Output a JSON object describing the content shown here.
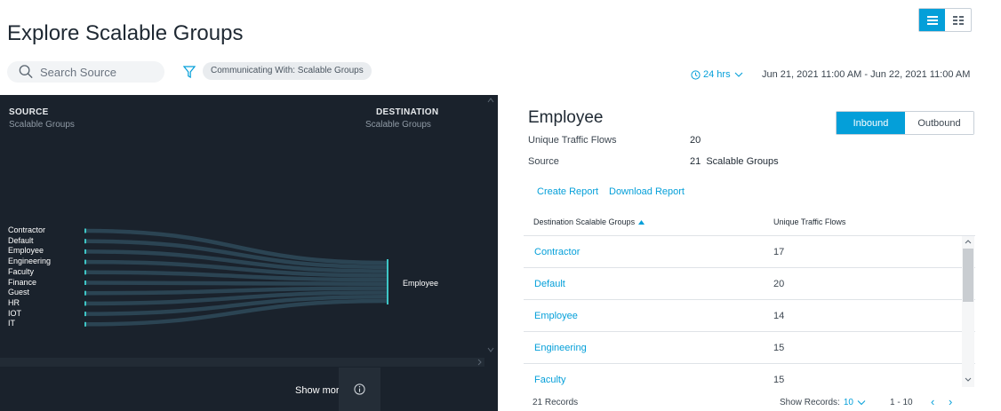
{
  "header": {
    "title": "Explore Scalable Groups",
    "view_toggle": {
      "selected": "list-view-icon",
      "other": "grid-view-icon"
    }
  },
  "toolbar": {
    "search_placeholder": "Search Source",
    "filter_chip": "Communicating With: Scalable Groups",
    "time_range": "24 hrs",
    "date_range": "Jun 21, 2021 11:00 AM - Jun 22, 2021 11:00 AM"
  },
  "viz": {
    "source_heading": "SOURCE",
    "source_sub": "Scalable Groups",
    "destination_heading": "DESTINATION",
    "destination_sub": "Scalable Groups",
    "sources": [
      "Contractor",
      "Default",
      "Employee",
      "Engineering",
      "Faculty",
      "Finance",
      "Guest",
      "HR",
      "IOT",
      "IT"
    ],
    "destination": "Employee",
    "show_more": "Show more",
    "colors": {
      "background": "#1a222c",
      "flow": "#2f4a5a",
      "node": "#3ec6c6"
    }
  },
  "panel": {
    "title": "Employee",
    "direction_tabs": [
      {
        "label": "Inbound",
        "active": true
      },
      {
        "label": "Outbound",
        "active": false
      }
    ],
    "unique_flows_label": "Unique Traffic Flows",
    "unique_flows_value": "20",
    "source_label": "Source",
    "source_value": "21  Scalable Groups",
    "create_report": "Create Report",
    "download_report": "Download Report",
    "table": {
      "col1": "Destination Scalable Groups",
      "col2": "Unique Traffic Flows",
      "rows": [
        {
          "group": "Contractor",
          "flows": "17"
        },
        {
          "group": "Default",
          "flows": "20"
        },
        {
          "group": "Employee",
          "flows": "14"
        },
        {
          "group": "Engineering",
          "flows": "15"
        },
        {
          "group": "Faculty",
          "flows": "15"
        }
      ]
    },
    "footer": {
      "records": "21 Records",
      "show_records_label": "Show Records:",
      "show_records_value": "10",
      "page_range": "1 - 10"
    },
    "colors": {
      "accent": "#049fd9"
    }
  }
}
